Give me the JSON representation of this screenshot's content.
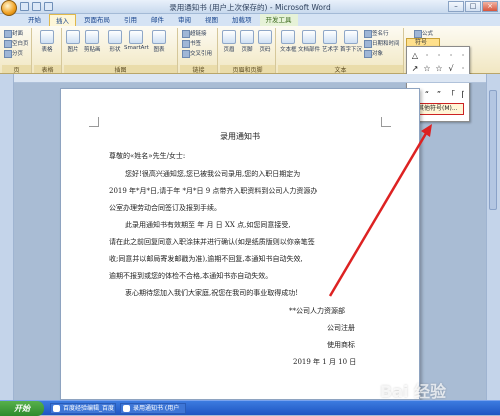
{
  "window": {
    "title": "录用通知书 (用户上次保存的) - Microsoft Word",
    "controls": [
      "–",
      "□",
      "×"
    ]
  },
  "tabs": [
    "开始",
    "插入",
    "页面布局",
    "引用",
    "邮件",
    "审阅",
    "视图",
    "加载项",
    "开发工具"
  ],
  "active_tab": "插入",
  "ribbon": {
    "groups": [
      "页",
      "表格",
      "插图",
      "链接",
      "页眉和页脚",
      "文本"
    ],
    "pages_buttons": [
      "封面",
      "空白页",
      "分页"
    ],
    "table_button": "表格",
    "illustration_buttons": [
      "图片",
      "剪贴画",
      "形状",
      "SmartArt",
      "图表"
    ],
    "link_buttons": [
      "超链接",
      "书签",
      "交叉引用"
    ],
    "header_footer_buttons": [
      "页眉",
      "页脚",
      "页码"
    ],
    "text_buttons": [
      "文本框",
      "文档部件",
      "艺术字",
      "首字下沉"
    ],
    "text_small_buttons": [
      "签名行",
      "日期和时间",
      "对象"
    ],
    "symbol_group": [
      "公式",
      "符号"
    ]
  },
  "symbol_panel": {
    "symbols": [
      "△",
      "·",
      "·",
      "·",
      "·",
      "↗",
      "☆",
      "☆",
      "√",
      "·",
      "·",
      "·",
      "·",
      "·",
      "·",
      "·",
      "“",
      "”",
      "「",
      "⌈",
      "※",
      "…",
      "·",
      "·",
      "·"
    ],
    "more_label": "其他符号(M)..."
  },
  "document": {
    "title": "录用通知书",
    "greeting": "尊敬的«姓名»先生/女士:",
    "lines": [
      "您好!很高兴通知您,您已被我公司录用,您的入职日期定为",
      "2019 年*月*日,请于年 *月*日 9 点带齐入职资料到公司人力资源办",
      "公室办理劳动合同签订及报到手续。",
      "此录用通知书有效期至  年   月   日 XX 点,如您同意接受,",
      "请在此之前回复同意入职涂抹并进行确认(如是纸质版则以你亲笔签",
      "收;同意并以邮局寄发邮戳为准),逾期不回复,本通知书自动失效,",
      "逾期不报到或您的体检不合格,本通知书亦自动失效。",
      "衷心期待您加入我们大家庭,祝您在我司的事业取得成功!"
    ],
    "signature": [
      "**公司人力资源部",
      "公司注册",
      "使用商标",
      "2019 年 1 月 10 日"
    ]
  },
  "taskbar": {
    "start": "开始",
    "tasks": [
      "百度经验编辑_百度",
      "录用通知书 (用户"
    ]
  },
  "watermark": "Bai 经验",
  "colors": {
    "annotation": "#dd2222",
    "ribbon_bg": "#f1e7c2"
  }
}
